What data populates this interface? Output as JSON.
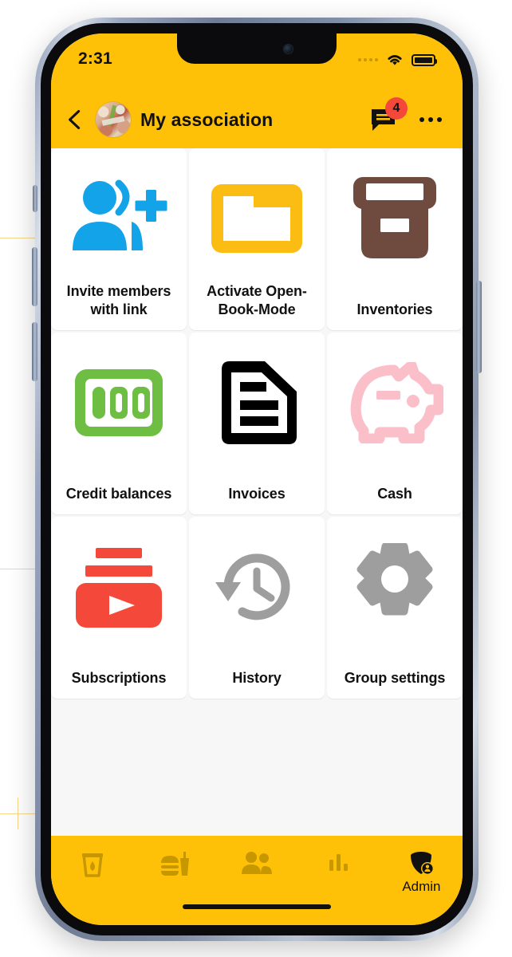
{
  "status_bar": {
    "time": "2:31",
    "signal_dots": 4,
    "wifi_icon": "wifi-icon",
    "battery_icon": "battery-full-icon"
  },
  "header": {
    "back_icon": "chevron-left-icon",
    "avatar_icon": "group-avatar-photo",
    "title": "My association",
    "chat_icon": "chat-bubble-icon",
    "chat_badge": "4",
    "menu_icon": "overflow-menu-icon"
  },
  "colors": {
    "brand_yellow": "#FFC107",
    "badge_red": "#F4483B",
    "invite_blue": "#13A3E8",
    "folder_yellow": "#FBBC13",
    "inventory_brown": "#6E4B3E",
    "credit_green": "#6FBE44",
    "invoice_black": "#000000",
    "cash_pink": "#FBBFC9",
    "subscription_red": "#F4483B",
    "history_gray": "#9E9E9E",
    "settings_gray": "#9E9E9E",
    "tab_inactive": "#C79700",
    "page_bg": "#F7F7F7"
  },
  "grid": {
    "tiles": [
      {
        "label": "Invite members with link",
        "icon": "person-add-icon",
        "color": "#13A3E8"
      },
      {
        "label": "Activate Open-Book-Mode",
        "icon": "folder-icon",
        "color": "#FBBC13"
      },
      {
        "label": "Inventories",
        "icon": "archive-box-icon",
        "color": "#6E4B3E"
      },
      {
        "label": "Credit balances",
        "icon": "banknote-100-icon",
        "color": "#6FBE44"
      },
      {
        "label": "Invoices",
        "icon": "document-lines-icon",
        "color": "#000000"
      },
      {
        "label": "Cash",
        "icon": "piggy-bank-icon",
        "color": "#FBBFC9"
      },
      {
        "label": "Subscriptions",
        "icon": "subscriptions-play-icon",
        "color": "#F4483B"
      },
      {
        "label": "History",
        "icon": "clock-rewind-icon",
        "color": "#9E9E9E"
      },
      {
        "label": "Group settings",
        "icon": "gear-icon",
        "color": "#9E9E9E"
      }
    ]
  },
  "tab_bar": {
    "tabs": [
      {
        "label": "",
        "icon": "drink-glass-icon",
        "active": false
      },
      {
        "label": "",
        "icon": "food-burger-drink-icon",
        "active": false
      },
      {
        "label": "",
        "icon": "people-icon",
        "active": false
      },
      {
        "label": "",
        "icon": "bar-chart-icon",
        "active": false
      },
      {
        "label": "Admin",
        "icon": "shield-admin-icon",
        "active": true
      }
    ]
  }
}
